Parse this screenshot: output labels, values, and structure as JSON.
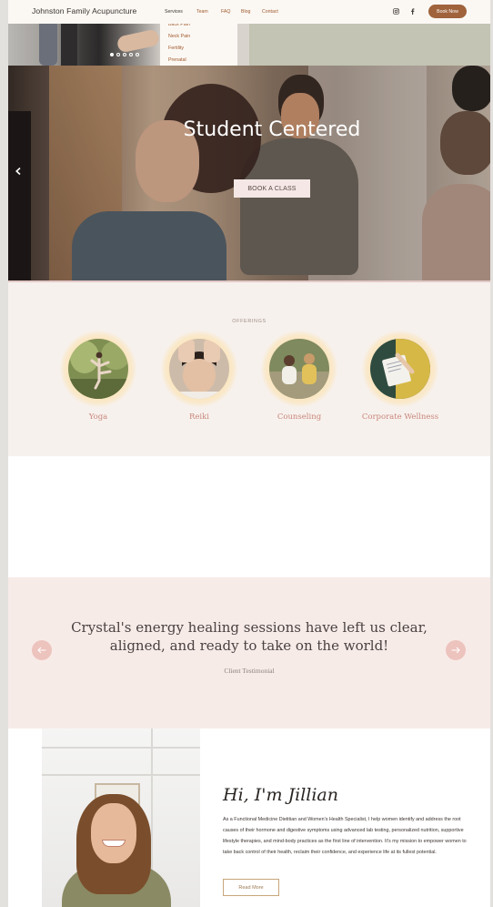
{
  "header": {
    "brand": "Johnston Family Acupuncture",
    "nav": [
      "Services",
      "Team",
      "FAQ",
      "Blog",
      "Contact"
    ],
    "social": [
      "instagram-icon",
      "facebook-icon"
    ],
    "cta": "Book Now"
  },
  "services_dropdown": [
    "Back Pain",
    "Neck Pain",
    "Fertility",
    "Prenatal"
  ],
  "hero": {
    "title": "Student Centered",
    "button": "BOOK A CLASS",
    "prev_icon": "chevron-left-icon"
  },
  "offerings": {
    "label": "OFFERINGS",
    "items": [
      {
        "name": "Yoga"
      },
      {
        "name": "Reiki"
      },
      {
        "name": "Counseling"
      },
      {
        "name": "Corporate Wellness"
      }
    ]
  },
  "testimonial": {
    "quote": "Crystal's energy healing sessions have left us clear, aligned, and ready to take on the world!",
    "cite": "Client Testimonial",
    "prev_icon": "arrow-left-icon",
    "next_icon": "arrow-right-icon"
  },
  "about": {
    "title": "Hi, I'm Jillian",
    "text": "As a Functional Medicine Dietitian and Women's Health Specialist, I help women identify and address the root causes of their hormone and digestive symptoms using advanced lab testing, personalized nutrition, supportive lifestyle therapies, and mind-body practices as the first line of intervention. It's my mission to empower women to take back control of their health, reclaim their confidence, and experience life at its fullest potential.",
    "button": "Read More"
  },
  "colors": {
    "accent": "#a0633c",
    "offerings_bg": "#f7f1ed",
    "testimonial_bg": "#f7ebe8",
    "offering_label": "#c8867b"
  }
}
